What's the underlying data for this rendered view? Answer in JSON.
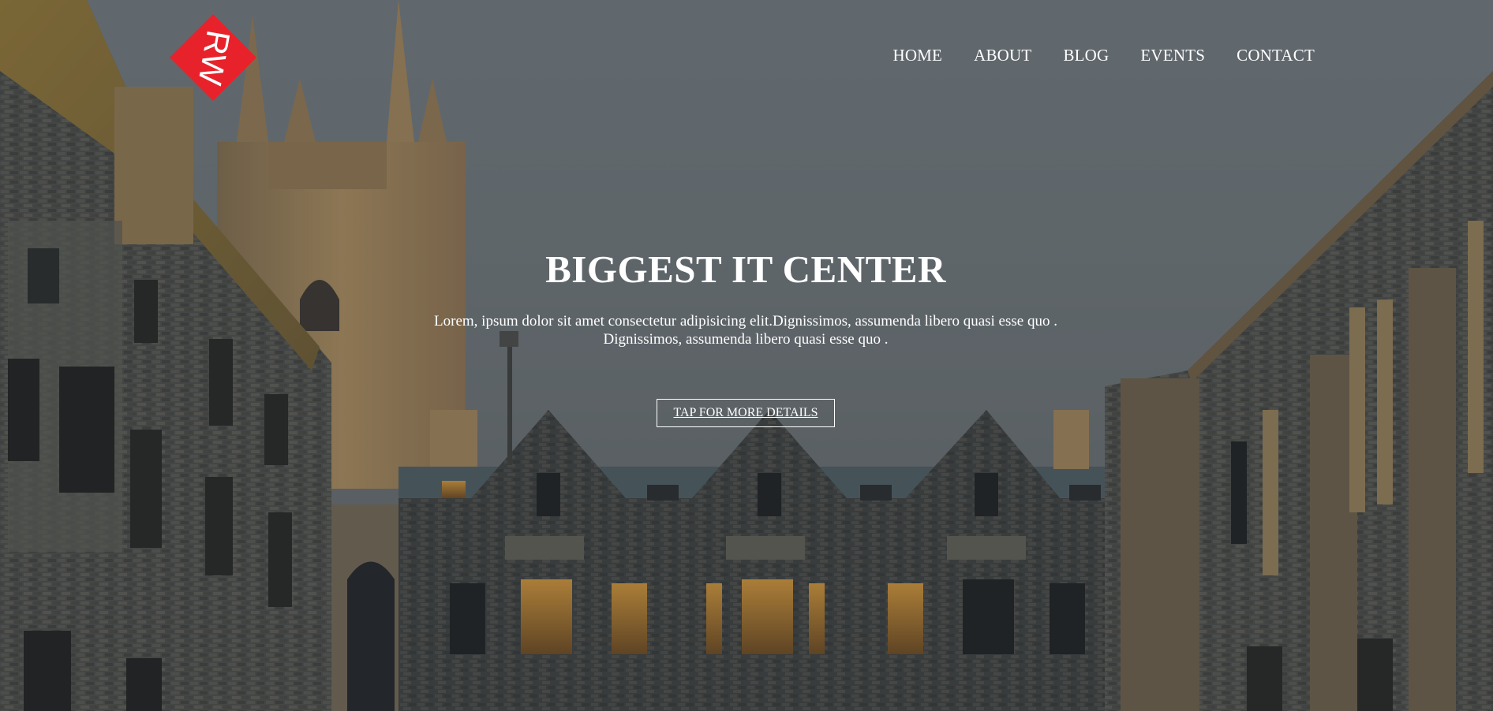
{
  "brand": {
    "logo_text": "RW",
    "logo_color": "#e8222b"
  },
  "nav": {
    "items": [
      {
        "label": "HOME"
      },
      {
        "label": "ABOUT"
      },
      {
        "label": "BLOG"
      },
      {
        "label": "EVENTS"
      },
      {
        "label": "CONTACT"
      }
    ]
  },
  "hero": {
    "title": "BIGGEST IT CENTER",
    "subtitle_line1": "Lorem, ipsum dolor sit amet consectetur adipisicing elit.Dignissimos, assumenda libero quasi esse quo .",
    "subtitle_line2": "Dignissimos, assumenda libero quasi esse quo .",
    "cta_label": "TAP FOR MORE DETAILS",
    "background": "university-building-photo"
  }
}
